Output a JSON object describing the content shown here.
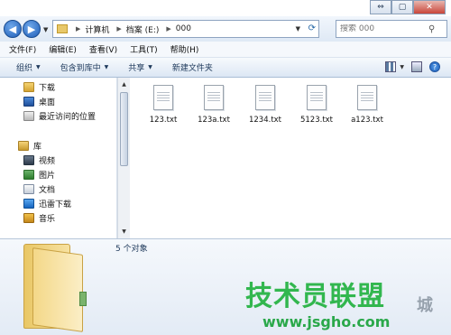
{
  "title_controls": {
    "minimize": "⇔",
    "maximize": "▢",
    "close": "✕"
  },
  "address": {
    "crumbs": [
      "计算机",
      "档案 (E:)",
      "000"
    ],
    "search_placeholder": "搜索 000"
  },
  "menu": [
    "文件(F)",
    "编辑(E)",
    "查看(V)",
    "工具(T)",
    "帮助(H)"
  ],
  "commands": [
    {
      "label": "组织",
      "has_dropdown": true
    },
    {
      "label": "包含到库中",
      "has_dropdown": true
    },
    {
      "label": "共享",
      "has_dropdown": true
    },
    {
      "label": "新建文件夹",
      "has_dropdown": false
    }
  ],
  "nav": {
    "favorites": [
      {
        "label": "下载",
        "icon": "download-folder-icon"
      },
      {
        "label": "桌面",
        "icon": "desktop-icon"
      },
      {
        "label": "最近访问的位置",
        "icon": "recent-places-icon"
      }
    ],
    "library_label": "库",
    "libraries": [
      {
        "label": "视频",
        "icon": "video-icon"
      },
      {
        "label": "图片",
        "icon": "pictures-icon"
      },
      {
        "label": "文档",
        "icon": "documents-icon"
      },
      {
        "label": "迅雷下载",
        "icon": "thunder-download-icon"
      },
      {
        "label": "音乐",
        "icon": "music-icon"
      }
    ]
  },
  "files": [
    "123.txt",
    "123a.txt",
    "1234.txt",
    "5123.txt",
    "a123.txt"
  ],
  "details": {
    "count": "5 个对象"
  },
  "watermark": {
    "text": "技术员联盟",
    "url": "www.jsgho.com",
    "tail": "城"
  }
}
